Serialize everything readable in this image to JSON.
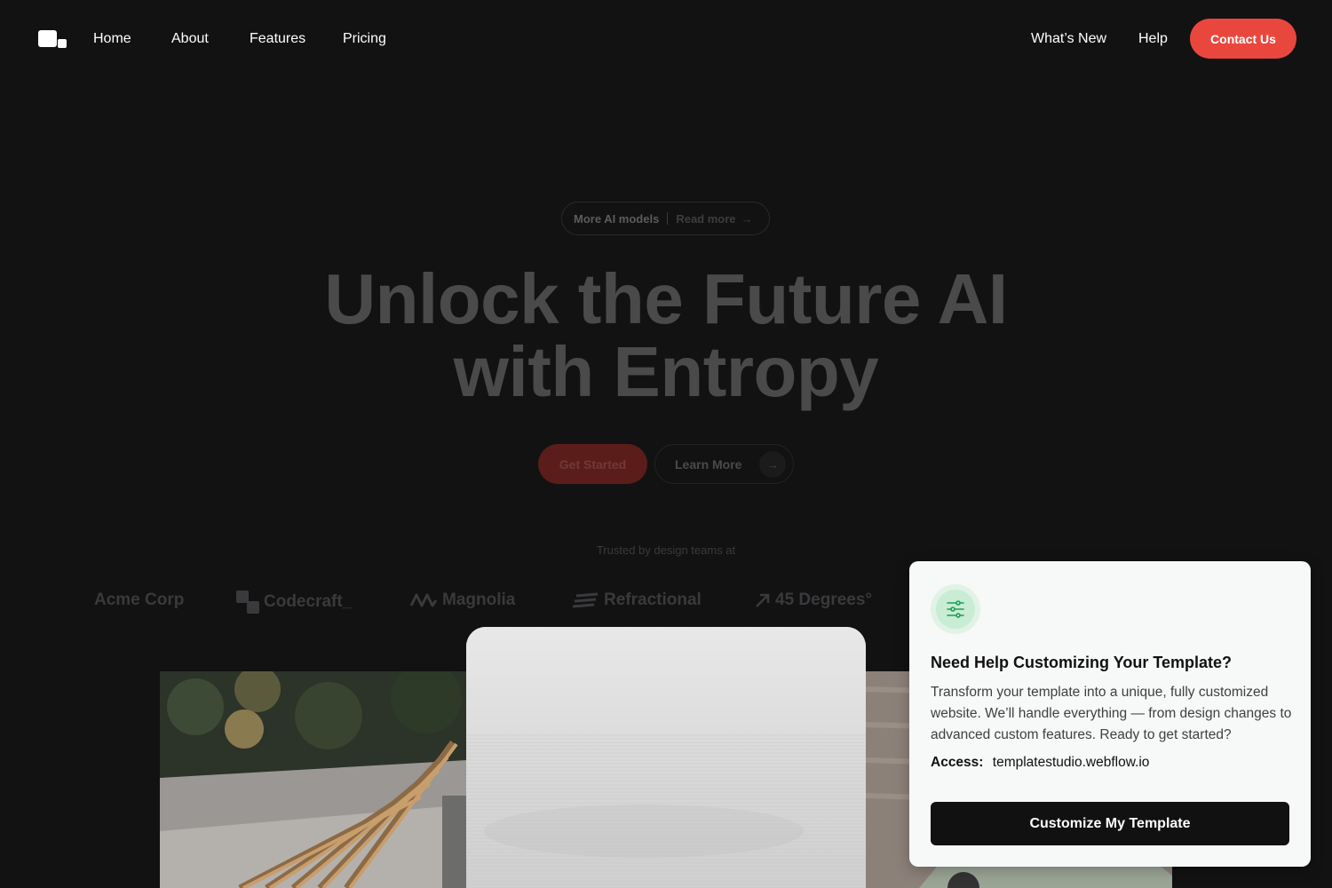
{
  "nav": {
    "links_left": [
      "Home",
      "About",
      "Features",
      "Pricing"
    ],
    "links_right": [
      "What’s New",
      "Help"
    ],
    "contact_label": "Contact Us"
  },
  "hero": {
    "pill_label": "More AI models",
    "pill_link": "Read more",
    "headline_line1": "Unlock the Future AI",
    "headline_line2": "with Entropy",
    "primary_cta": "Get Started",
    "secondary_cta": "Learn More",
    "trusted_text": "Trusted by design teams at",
    "brands": [
      "Acme Corp",
      "Codecraft_",
      "Magnolia",
      "Refractional",
      "45 Degrees°"
    ]
  },
  "popup": {
    "title": "Need Help Customizing Your Template?",
    "body": "Transform your template into a unique, fully customized website. We’ll handle everything — from design changes to advanced custom features. Ready to get started?",
    "access_label": "Access:",
    "access_value": "templatestudio.webflow.io",
    "button_label": "Customize My Template"
  },
  "colors": {
    "background": "#121213",
    "accent": "#e9473e",
    "popup_bg": "#f7f8f8",
    "popup_icon": "#1f9d55"
  },
  "icons": [
    "logo-icon",
    "arrow-right-icon",
    "sliders-icon"
  ]
}
